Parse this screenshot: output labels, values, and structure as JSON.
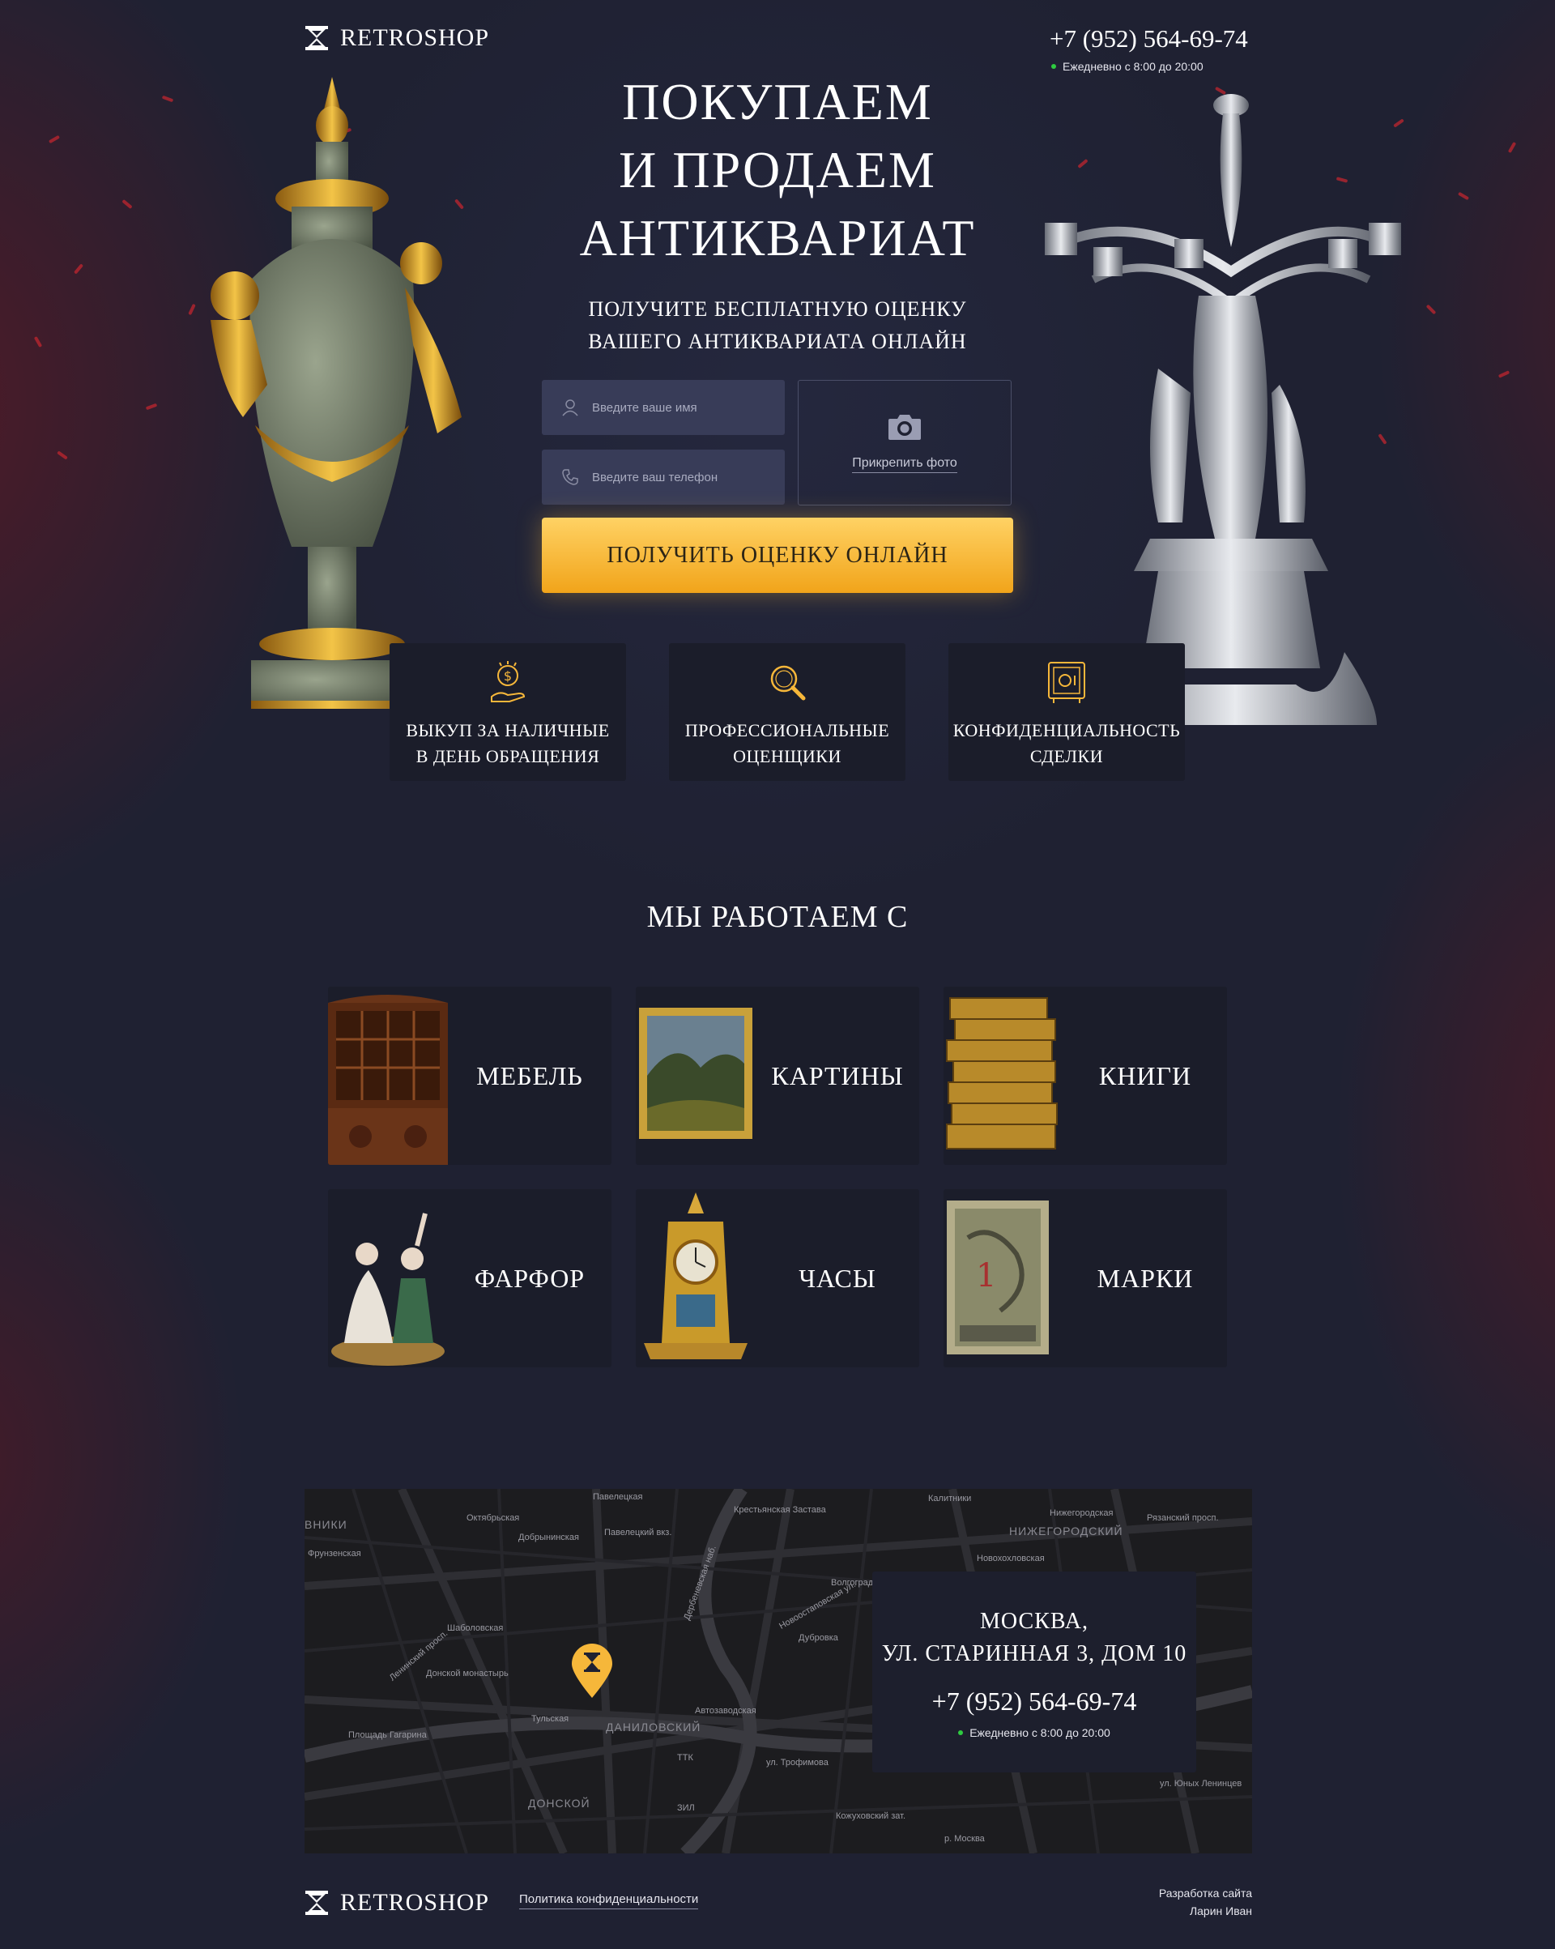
{
  "header": {
    "logo_text": "RETROSHOP",
    "phone": "+7 (952) 564-69-74",
    "hours": "Ежедневно с 8:00 до 20:00"
  },
  "hero": {
    "title_line1": "ПОКУПАЕМ",
    "title_line2": "И ПРОДАЕМ",
    "title_line3": "АНТИКВАРИАТ",
    "subtitle_line1": "ПОЛУЧИТЕ БЕСПЛАТНУЮ ОЦЕНКУ",
    "subtitle_line2": "ВАШЕГО АНТИКВАРИАТА ОНЛАЙН"
  },
  "form": {
    "name_placeholder": "Введите ваше имя",
    "phone_placeholder": "Введите ваш телефон",
    "attach_label": "Прикрепить фото",
    "submit_label": "ПОЛУЧИТЬ ОЦЕНКУ ОНЛАЙН"
  },
  "features": [
    {
      "line1": "ВЫКУП ЗА НАЛИЧНЫЕ",
      "line2": "В ДЕНЬ ОБРАЩЕНИЯ",
      "icon": "cash-hand-icon"
    },
    {
      "line1": "ПРОФЕССИОНАЛЬНЫЕ",
      "line2": "ОЦЕНЩИКИ",
      "icon": "magnifier-icon"
    },
    {
      "line1": "КОНФИДЕНЦИАЛЬНОСТЬ",
      "line2": "СДЕЛКИ",
      "icon": "safe-icon"
    }
  ],
  "categories_title": "МЫ РАБОТАЕМ С",
  "categories": [
    {
      "label": "МЕБЕЛЬ"
    },
    {
      "label": "КАРТИНЫ"
    },
    {
      "label": "КНИГИ"
    },
    {
      "label": "ФАРФОР"
    },
    {
      "label": "ЧАСЫ"
    },
    {
      "label": "МАРКИ"
    }
  ],
  "map": {
    "city": "МОСКВА,",
    "street": "УЛ. СТАРИННАЯ 3, ДОМ 10",
    "phone": "+7 (952) 564-69-74",
    "hours": "Ежедневно с 8:00 до 20:00",
    "labels": {
      "l1": "Павелецкая",
      "l2": "Крестьянская Застава",
      "l3": "Калитники",
      "l4": "Нижегородская",
      "l5": "Рязанский просп.",
      "l6": "НИЖЕГОРОДСКИЙ",
      "l7": "Октябрьская",
      "l8": "Добрынинская",
      "l9": "Павелецкий вкз.",
      "l10": "Фрунзенская",
      "l11": "Новохохловская",
      "l12": "Шаболовская",
      "l13": "Ленинский просп.",
      "l14": "Донской монастырь",
      "l15": "Дубровка",
      "l16": "Тульская",
      "l17": "ДАНИЛОВСКИЙ",
      "l18": "Автозаводская",
      "l19": "Площадь Гагарина",
      "l20": "ТТК",
      "l21": "ДОНСКОЙ",
      "l22": "ЗИЛ",
      "l23": "ул. Трофимова",
      "l24": "Кожуховский зат.",
      "l25": "ул. Юных Ленинцев",
      "l26": "р. Москва",
      "l27": "ВНИКИ",
      "l28": "Новоостаповская ул.",
      "l29": "Волгоградский просп.",
      "l30": "Дербеневская наб."
    }
  },
  "footer": {
    "logo_text": "RETROSHOP",
    "policy_link": "Политика конфиденциальности",
    "dev_line1": "Разработка сайта",
    "dev_line2": "Ларин Иван"
  },
  "colors": {
    "background": "#1f2132",
    "accent": "#f6b73a",
    "card": "#1b1d2a",
    "input": "#383c58",
    "online": "#2ecc40"
  }
}
